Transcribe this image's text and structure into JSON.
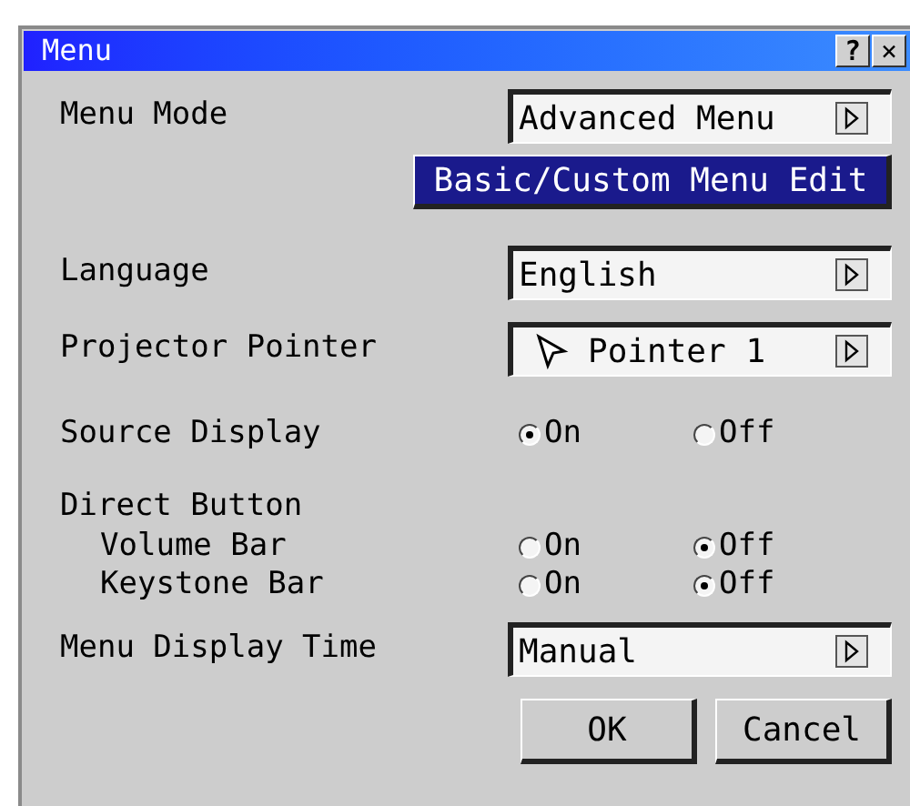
{
  "window": {
    "title": "Menu",
    "help": "?",
    "close": "×"
  },
  "rows": [
    {
      "kind": "select",
      "label": "Menu Mode",
      "value": "Advanced Menu"
    },
    {
      "kind": "button",
      "label": "Basic/Custom Menu Edit"
    },
    {
      "kind": "select",
      "label": "Language",
      "value": "English"
    },
    {
      "kind": "pointer",
      "label": "Projector Pointer",
      "value": "Pointer 1"
    },
    {
      "kind": "radio",
      "label": "Source Display",
      "options": [
        {
          "label": "On",
          "selected": true
        },
        {
          "label": "Off",
          "selected": false
        }
      ]
    },
    {
      "kind": "heading",
      "label": "Direct Button"
    },
    {
      "kind": "subradio",
      "label": "Volume Bar",
      "options": [
        {
          "label": "On",
          "selected": false
        },
        {
          "label": "Off",
          "selected": true
        }
      ]
    },
    {
      "kind": "subradio",
      "label": "Keystone Bar",
      "options": [
        {
          "label": "On",
          "selected": false
        },
        {
          "label": "Off",
          "selected": true
        }
      ]
    },
    {
      "kind": "select",
      "label": "Menu Display Time",
      "value": "Manual"
    }
  ],
  "buttons": [
    "OK",
    "Cancel"
  ]
}
